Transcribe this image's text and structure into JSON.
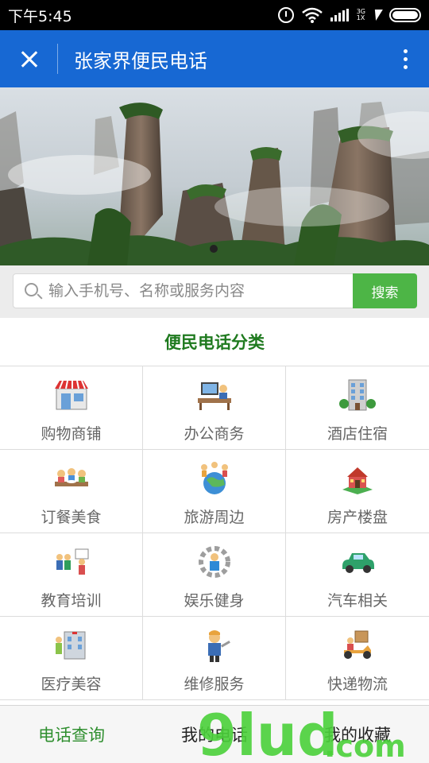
{
  "status_bar": {
    "time": "下午5:45",
    "network": [
      "3G",
      "1X"
    ]
  },
  "app_bar": {
    "title": "张家界便民电话",
    "close_icon": "close-icon",
    "more_icon": "more-vertical-icon"
  },
  "banner": {
    "alt": "scenery-banner-image"
  },
  "search": {
    "placeholder": "输入手机号、名称或服务内容",
    "button_label": "搜索"
  },
  "section": {
    "title": "便民电话分类"
  },
  "categories": [
    {
      "label": "购物商铺",
      "icon": "shop-icon"
    },
    {
      "label": "办公商务",
      "icon": "office-icon"
    },
    {
      "label": "酒店住宿",
      "icon": "hotel-icon"
    },
    {
      "label": "订餐美食",
      "icon": "food-icon"
    },
    {
      "label": "旅游周边",
      "icon": "travel-icon"
    },
    {
      "label": "房产楼盘",
      "icon": "house-icon"
    },
    {
      "label": "教育培训",
      "icon": "education-icon"
    },
    {
      "label": "娱乐健身",
      "icon": "fitness-icon"
    },
    {
      "label": "汽车相关",
      "icon": "car-icon"
    },
    {
      "label": "医疗美容",
      "icon": "medical-icon"
    },
    {
      "label": "维修服务",
      "icon": "repair-icon"
    },
    {
      "label": "快递物流",
      "icon": "delivery-icon"
    }
  ],
  "bottom_nav": [
    {
      "label": "电话查询",
      "active": true
    },
    {
      "label": "我的电话",
      "active": false
    },
    {
      "label": "我的收藏",
      "active": false
    }
  ],
  "colors": {
    "app_bar": "#1768d3",
    "accent_green": "#4db546",
    "title_green": "#1f7a1f"
  }
}
